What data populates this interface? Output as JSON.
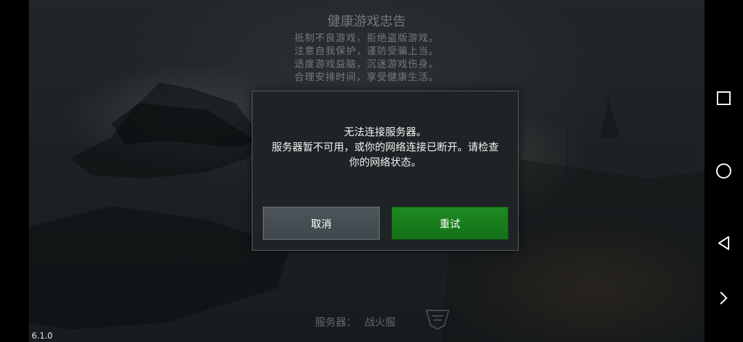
{
  "health_notice": {
    "title": "健康游戏忠告",
    "lines": [
      "抵制不良游戏，拒绝盗版游戏。",
      "注意自我保护，谨防受骗上当。",
      "适度游戏益脑，沉迷游戏伤身。",
      "合理安排时间，享受健康生活。"
    ]
  },
  "dialog": {
    "message_lines": [
      "无法连接服务器。",
      "服务器暂不可用，或你的网络连接已断开。请检查",
      "你的网络状态。"
    ],
    "cancel_label": "取消",
    "retry_label": "重试"
  },
  "server": {
    "label": "服务器：",
    "name": "战火服"
  },
  "version": "6.1.0",
  "nav_icons": [
    "recent-apps-icon",
    "home-icon",
    "back-icon",
    "expand-icon"
  ],
  "colors": {
    "retry": "#1a7d1e",
    "cancel": "#465055",
    "dialog_bg": "#1f2325"
  }
}
